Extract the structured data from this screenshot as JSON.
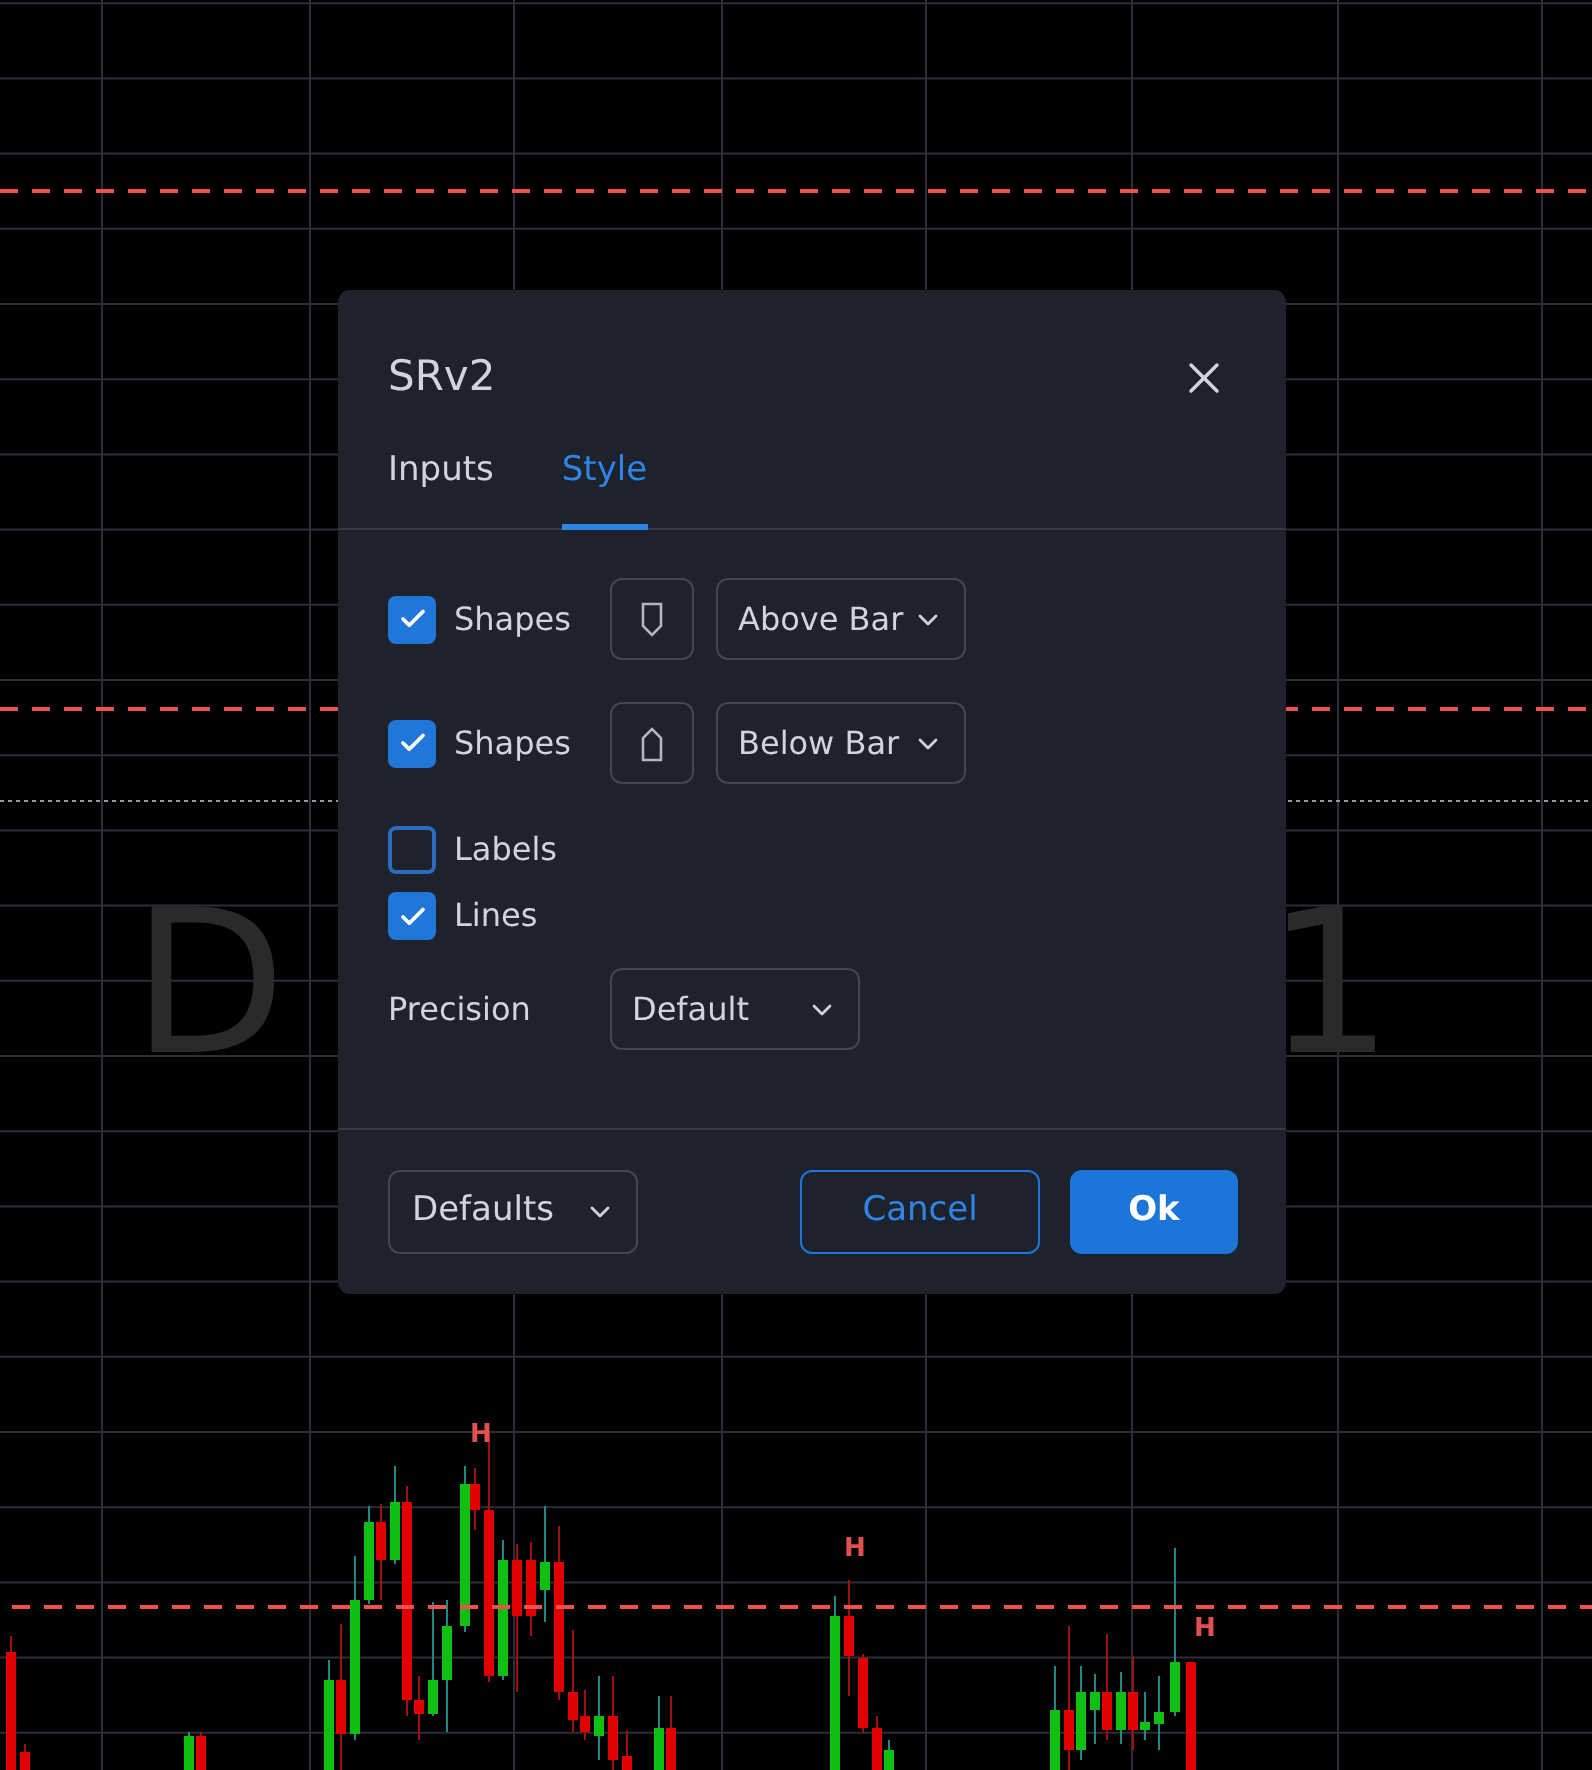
{
  "chart": {
    "watermark": [
      {
        "text": "D"
      },
      {
        "text": "1"
      }
    ],
    "markers": [
      {
        "text": "H"
      },
      {
        "text": "H"
      },
      {
        "text": "H"
      }
    ]
  },
  "dialog": {
    "title": "SRv2",
    "tabs": [
      {
        "label": "Inputs",
        "selected": false
      },
      {
        "label": "Style",
        "selected": true
      }
    ],
    "rows": [
      {
        "kind": "shape_above",
        "label": "Shapes",
        "checked": true,
        "value": "Above Bar"
      },
      {
        "kind": "shape_below",
        "label": "Shapes",
        "checked": true,
        "value": "Below Bar"
      },
      {
        "kind": "check",
        "label": "Labels",
        "checked": false
      },
      {
        "kind": "check",
        "label": "Lines",
        "checked": true
      },
      {
        "kind": "select",
        "label": "Precision",
        "value": "Default"
      }
    ],
    "defaults": "Defaults",
    "buttons": [
      {
        "label": "Cancel",
        "kind": "secondary"
      },
      {
        "label": "Ok",
        "kind": "primary"
      }
    ]
  }
}
